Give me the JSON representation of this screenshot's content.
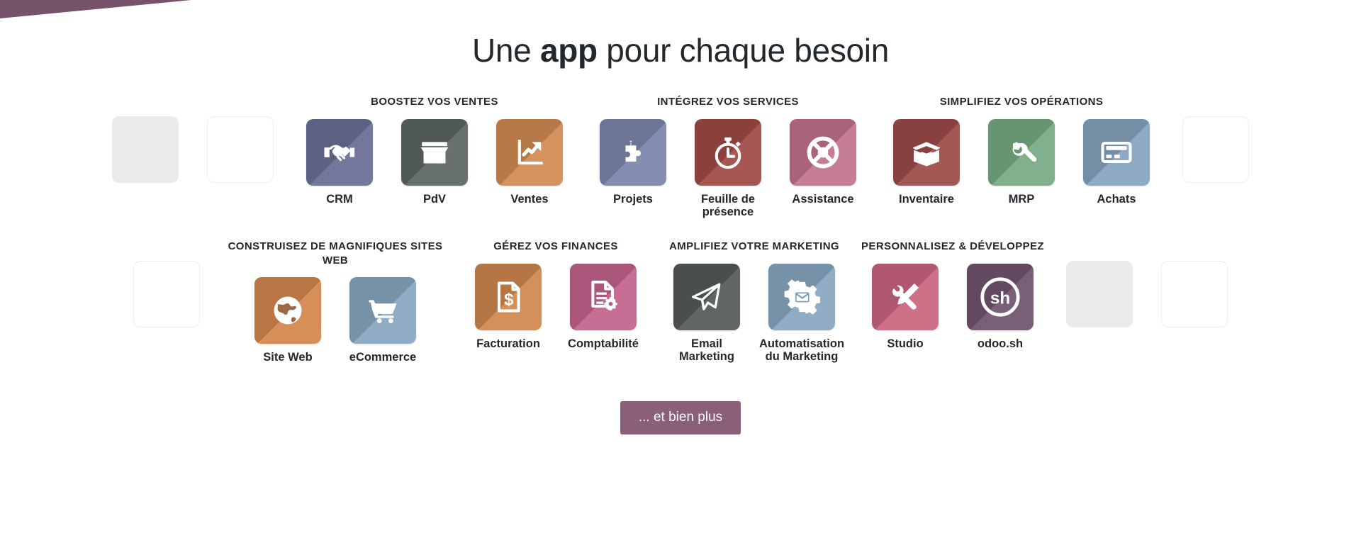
{
  "decor": {
    "wedge_color": "#76526b"
  },
  "header": {
    "title_prefix": "Une ",
    "title_bold": "app",
    "title_suffix": " pour chaque besoin"
  },
  "rows": [
    {
      "left_edge": [
        {
          "style": "filled"
        },
        {
          "style": "outline"
        }
      ],
      "groups": [
        {
          "title": "BOOSTEZ VOS VENTES",
          "apps": [
            {
              "label": "CRM",
              "icon": "handshake-icon",
              "color": "#6a6e96",
              "accent": "#585c82"
            },
            {
              "label": "PdV",
              "icon": "storefront-icon",
              "color": "#5d6662",
              "accent": "#4d5551"
            },
            {
              "label": "Ventes",
              "icon": "chart-arrow-icon",
              "color": "#d08a52",
              "accent": "#b87645"
            }
          ]
        },
        {
          "title": "INTÉGREZ VOS SERVICES",
          "apps": [
            {
              "label": "Projets",
              "icon": "puzzle-piece-icon",
              "color": "#7c86ab",
              "accent": "#6a7499"
            },
            {
              "label": "Feuille de présence",
              "icon": "stopwatch-icon",
              "color": "#a04a45",
              "accent": "#8a3f3a"
            },
            {
              "label": "Assistance",
              "icon": "lifebuoy-icon",
              "color": "#c2738e",
              "accent": "#ab6180"
            }
          ]
        },
        {
          "title": "SIMPLIFIEZ VOS OPÉRATIONS",
          "apps": [
            {
              "label": "Inventaire",
              "icon": "open-box-icon",
              "color": "#9c4b47",
              "accent": "#85403c"
            },
            {
              "label": "MRP",
              "icon": "wrench-icon",
              "color": "#76ab83",
              "accent": "#649473"
            },
            {
              "label": "Achats",
              "icon": "credit-card-icon",
              "color": "#85a3bf",
              "accent": "#7391ae"
            }
          ]
        }
      ],
      "right_edge": [
        {
          "style": "outline"
        }
      ]
    },
    {
      "left_edge": [
        {
          "style": "outline"
        }
      ],
      "groups": [
        {
          "title": "CONSTRUISEZ DE MAGNIFIQUES SITES WEB",
          "apps": [
            {
              "label": "Site Web",
              "icon": "globe-icon",
              "color": "#d4874e",
              "accent": "#b97142"
            },
            {
              "label": "eCommerce",
              "icon": "shopping-cart-icon",
              "color": "#88a7c1",
              "accent": "#7694b0"
            }
          ]
        },
        {
          "title": "GÉREZ VOS FINANCES",
          "apps": [
            {
              "label": "Facturation",
              "icon": "invoice-dollar-icon",
              "color": "#d0884f",
              "accent": "#b67442"
            },
            {
              "label": "Comptabilité",
              "icon": "document-gear-icon",
              "color": "#c2638c",
              "accent": "#a9547a"
            }
          ]
        },
        {
          "title": "AMPLIFIEZ VOTRE MARKETING",
          "apps": [
            {
              "label": "Email Marketing",
              "icon": "paper-plane-icon",
              "color": "#55595a",
              "accent": "#44484a"
            },
            {
              "label": "Automatisation du Marketing",
              "icon": "gear-envelope-icon",
              "color": "#88a7c1",
              "accent": "#7694b0"
            }
          ]
        },
        {
          "title": "PERSONNALISEZ & DÉVELOPPEZ",
          "apps": [
            {
              "label": "Studio",
              "icon": "wrench-pencil-icon",
              "color": "#c9657f",
              "accent": "#b1556e"
            },
            {
              "label": "odoo.sh",
              "icon": "sh-circle-icon",
              "color": "#70536f",
              "accent": "#5e4460"
            }
          ]
        }
      ],
      "right_edge": [
        {
          "style": "filled"
        },
        {
          "style": "outline"
        }
      ]
    }
  ],
  "cta": {
    "label": "... et bien plus",
    "color": "#8a5f79"
  }
}
